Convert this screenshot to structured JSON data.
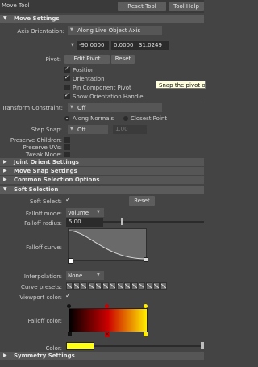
{
  "window": {
    "title": "Move Tool",
    "reset_label": "Reset Tool",
    "help_label": "Tool Help"
  },
  "move_settings": {
    "header": "Move Settings",
    "axis_orientation_label": "Axis Orientation:",
    "axis_orientation_value": "Along Live Object Axis",
    "coords": [
      "-90.0000",
      "0.0000",
      "31.0249"
    ],
    "pivot_label": "Pivot:",
    "edit_pivot_label": "Edit Pivot",
    "reset_label": "Reset",
    "position_label": "Position",
    "orientation_label": "Orientation",
    "pin_component_pivot_label": "Pin Component Pivot",
    "show_orientation_handle_label": "Show Orientation Handle",
    "tooltip": "Snap the pivot ori",
    "transform_constraint_label": "Transform Constraint:",
    "transform_constraint_value": "Off",
    "along_normals_label": "Along Normals",
    "closest_point_label": "Closest Point",
    "step_snap_label": "Step Snap:",
    "step_snap_value": "Off",
    "step_snap_amount": "1.00",
    "preserve_children_label": "Preserve Children:",
    "preserve_uvs_label": "Preserve UVs:",
    "tweak_mode_label": "Tweak Mode:"
  },
  "collapsed_sections": {
    "joint_orient": "Joint Orient Settings",
    "move_snap": "Move Snap Settings",
    "common_selection": "Common Selection Options"
  },
  "soft_selection": {
    "header": "Soft Selection",
    "soft_select_label": "Soft Select:",
    "reset_label": "Reset",
    "falloff_mode_label": "Falloff mode:",
    "falloff_mode_value": "Volume",
    "falloff_radius_label": "Falloff radius:",
    "falloff_radius_value": "5.00",
    "falloff_radius_fraction": 0.18,
    "falloff_curve_label": "Falloff curve:",
    "interpolation_label": "Interpolation:",
    "interpolation_value": "None",
    "curve_presets_label": "Curve presets:",
    "viewport_color_label": "Viewport color:",
    "falloff_color_label": "Falloff color:",
    "color_label": "Color:",
    "color_swatch": "#ffff1a",
    "gradient_colors": [
      "#000000",
      "#cc0000",
      "#ffee00"
    ]
  },
  "symmetry": {
    "header": "Symmetry Settings"
  },
  "icons": [
    "triangle-down-icon",
    "triangle-right-icon",
    "check-icon",
    "dropdown-arrow-icon"
  ]
}
